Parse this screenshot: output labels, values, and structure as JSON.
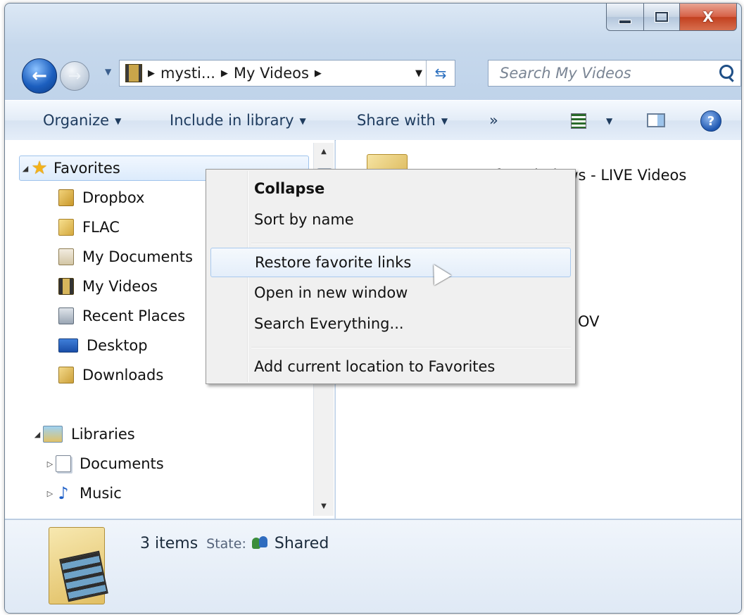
{
  "window": {
    "caption": {
      "minimize": "—",
      "maximize": "□",
      "close": "X"
    }
  },
  "nav": {
    "address": {
      "crumb1": "mysti...",
      "crumb2": "My Videos"
    },
    "search_placeholder": "Search My Videos"
  },
  "toolbar": {
    "organize": "Organize",
    "include_in_library": "Include in library",
    "share_with": "Share with",
    "more": "»"
  },
  "tree": {
    "favorites": {
      "label": "Favorites",
      "items": [
        "Dropbox",
        "FLAC",
        "My Documents",
        "My Videos",
        "Recent Places",
        "Desktop",
        "Downloads"
      ]
    },
    "libraries": {
      "label": "Libraries",
      "items": [
        "Documents",
        "Music"
      ]
    }
  },
  "content": {
    "item1": "Games for Windows - LIVE Videos",
    "item3_fragment": "OV"
  },
  "details": {
    "count": "3 items",
    "state_label": "State:",
    "state_value": "Shared"
  },
  "context_menu": {
    "items": [
      "Collapse",
      "Sort by name",
      "Restore favorite links",
      "Open in new window",
      "Search Everything...",
      "Add current location to Favorites"
    ]
  }
}
